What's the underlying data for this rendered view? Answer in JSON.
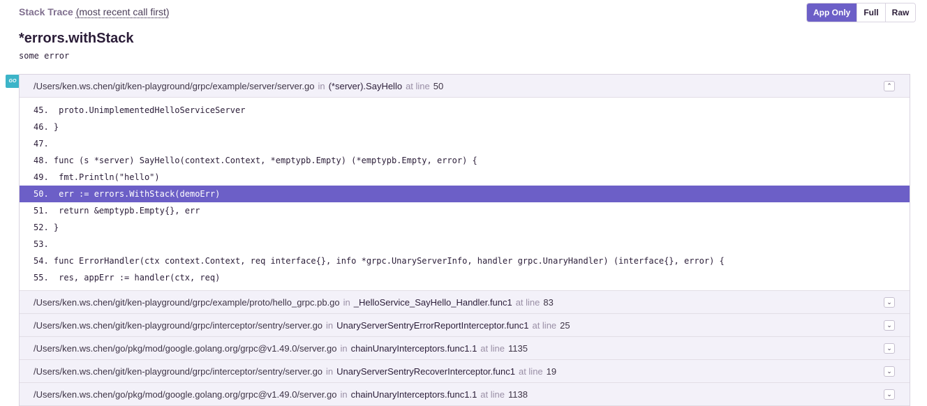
{
  "header": {
    "title": "Stack Trace",
    "subtitle": "(most recent call first)"
  },
  "view_buttons": [
    {
      "label": "App Only",
      "active": true
    },
    {
      "label": "Full",
      "active": false
    },
    {
      "label": "Raw",
      "active": false
    }
  ],
  "exception": {
    "type": "*errors.withStack",
    "value": "some error"
  },
  "platform_icon": {
    "name": "go-icon",
    "text": "GO",
    "color": "#3cb4c8"
  },
  "labels": {
    "in": "in",
    "at_line": "at line"
  },
  "colors": {
    "accent": "#6c5fc7"
  },
  "frames": [
    {
      "file": "/Users/ken.ws.chen/git/ken-playground/grpc/example/server/server.go",
      "function": "(*server).SayHello",
      "line": "50",
      "expanded": true,
      "toggle_icon": "chevron-up-icon",
      "context": [
        {
          "text": "45.  proto.UnimplementedHelloServiceServer",
          "active": false
        },
        {
          "text": "46. }",
          "active": false
        },
        {
          "text": "47.",
          "active": false
        },
        {
          "text": "48. func (s *server) SayHello(context.Context, *emptypb.Empty) (*emptypb.Empty, error) {",
          "active": false
        },
        {
          "text": "49.  fmt.Println(\"hello\")",
          "active": false
        },
        {
          "text": "50.  err := errors.WithStack(demoErr)",
          "active": true
        },
        {
          "text": "51.  return &emptypb.Empty{}, err",
          "active": false
        },
        {
          "text": "52. }",
          "active": false
        },
        {
          "text": "53.",
          "active": false
        },
        {
          "text": "54. func ErrorHandler(ctx context.Context, req interface{}, info *grpc.UnaryServerInfo, handler grpc.UnaryHandler) (interface{}, error) {",
          "active": false
        },
        {
          "text": "55.  res, appErr := handler(ctx, req)",
          "active": false
        }
      ]
    },
    {
      "file": "/Users/ken.ws.chen/git/ken-playground/grpc/example/proto/hello_grpc.pb.go",
      "function": "_HelloService_SayHello_Handler.func1",
      "line": "83",
      "expanded": false,
      "toggle_icon": "chevron-down-icon"
    },
    {
      "file": "/Users/ken.ws.chen/git/ken-playground/grpc/interceptor/sentry/server.go",
      "function": "UnaryServerSentryErrorReportInterceptor.func1",
      "line": "25",
      "expanded": false,
      "toggle_icon": "chevron-down-icon"
    },
    {
      "file": "/Users/ken.ws.chen/go/pkg/mod/google.golang.org/grpc@v1.49.0/server.go",
      "function": "chainUnaryInterceptors.func1.1",
      "line": "1135",
      "expanded": false,
      "toggle_icon": "chevron-down-icon"
    },
    {
      "file": "/Users/ken.ws.chen/git/ken-playground/grpc/interceptor/sentry/server.go",
      "function": "UnaryServerSentryRecoverInterceptor.func1",
      "line": "19",
      "expanded": false,
      "toggle_icon": "chevron-down-icon"
    },
    {
      "file": "/Users/ken.ws.chen/go/pkg/mod/google.golang.org/grpc@v1.49.0/server.go",
      "function": "chainUnaryInterceptors.func1.1",
      "line": "1138",
      "expanded": false,
      "toggle_icon": "chevron-down-icon"
    }
  ]
}
